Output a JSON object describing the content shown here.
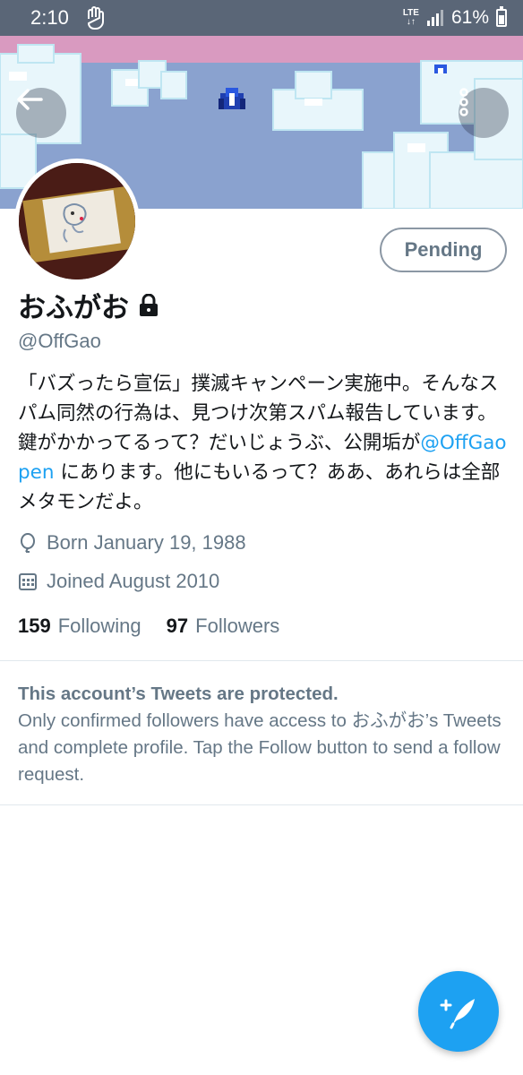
{
  "status_bar": {
    "time": "2:10",
    "network": "LTE",
    "battery": "61%"
  },
  "profile": {
    "display_name": "おふがお",
    "handle": "@OffGao",
    "follow_button": "Pending",
    "bio_before": "「バズったら宣伝」撲滅キャンペーン実施中。そんなスパム同然の行為は、見つけ次第スパム報告しています。 鍵がかかってるって？だいじょうぶ、公開垢が",
    "bio_link": "@OffGaopen",
    "bio_after": " にあります。他にもいるって？ああ、あれらは全部メタモンだよ。",
    "born": "Born January 19, 1988",
    "joined": "Joined August 2010",
    "following_count": "159",
    "following_label": "Following",
    "followers_count": "97",
    "followers_label": "Followers"
  },
  "protected_notice": {
    "title": "This account’s Tweets are protected.",
    "body": "Only confirmed followers have access to おふがお’s Tweets and complete profile. Tap the Follow button to send a follow request."
  },
  "colors": {
    "accent": "#1da1f2",
    "secondary_text": "#657786",
    "status_bar": "#5a6677"
  },
  "icons": {
    "back": "arrow-left-icon",
    "more": "more-vertical-icon",
    "lock": "lock-icon",
    "born": "balloon-icon",
    "joined": "calendar-icon",
    "compose": "compose-tweet-icon"
  }
}
